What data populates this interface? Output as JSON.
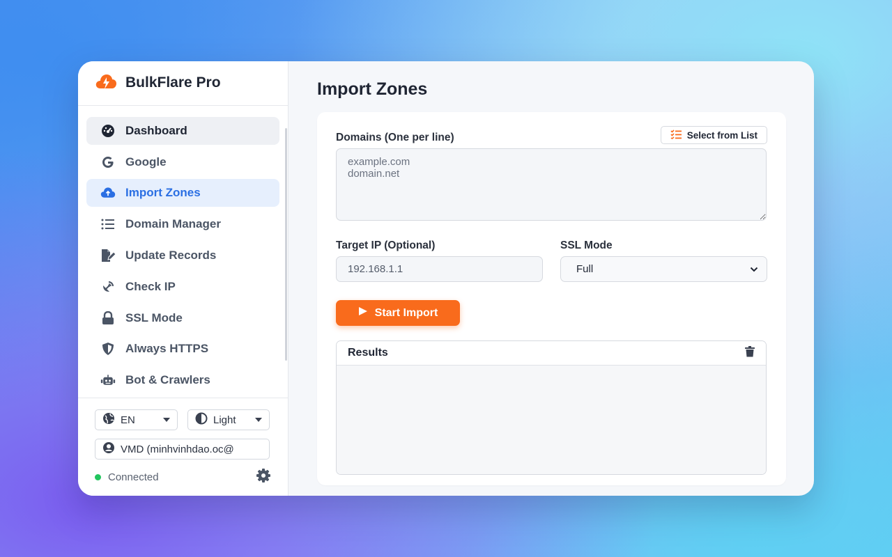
{
  "app": {
    "name": "BulkFlare Pro"
  },
  "sidebar": {
    "items": [
      {
        "label": "Dashboard",
        "icon": "gauge-icon"
      },
      {
        "label": "Google",
        "icon": "google-icon"
      },
      {
        "label": "Import Zones",
        "icon": "cloud-upload-icon",
        "active": true
      },
      {
        "label": "Domain Manager",
        "icon": "list-icon"
      },
      {
        "label": "Update Records",
        "icon": "file-edit-icon"
      },
      {
        "label": "Check IP",
        "icon": "satellite-dish-icon"
      },
      {
        "label": "SSL Mode",
        "icon": "lock-icon"
      },
      {
        "label": "Always HTTPS",
        "icon": "shield-icon"
      },
      {
        "label": "Bot & Crawlers",
        "icon": "robot-icon"
      }
    ],
    "language": "EN",
    "theme": "Light",
    "account": "VMD (minhvinhdao.oc@",
    "status": "Connected"
  },
  "main": {
    "title": "Import Zones",
    "domains_label": "Domains (One per line)",
    "select_from_list": "Select from List",
    "domains_placeholder": "example.com\ndomain.net",
    "target_ip_label": "Target IP (Optional)",
    "target_ip_placeholder": "192.168.1.1",
    "ssl_mode_label": "SSL Mode",
    "ssl_mode_value": "Full",
    "start_button": "Start Import",
    "results_title": "Results"
  },
  "colors": {
    "accent": "#f96b1c",
    "active_nav": "#2b6fe3",
    "status_green": "#22c55e"
  }
}
